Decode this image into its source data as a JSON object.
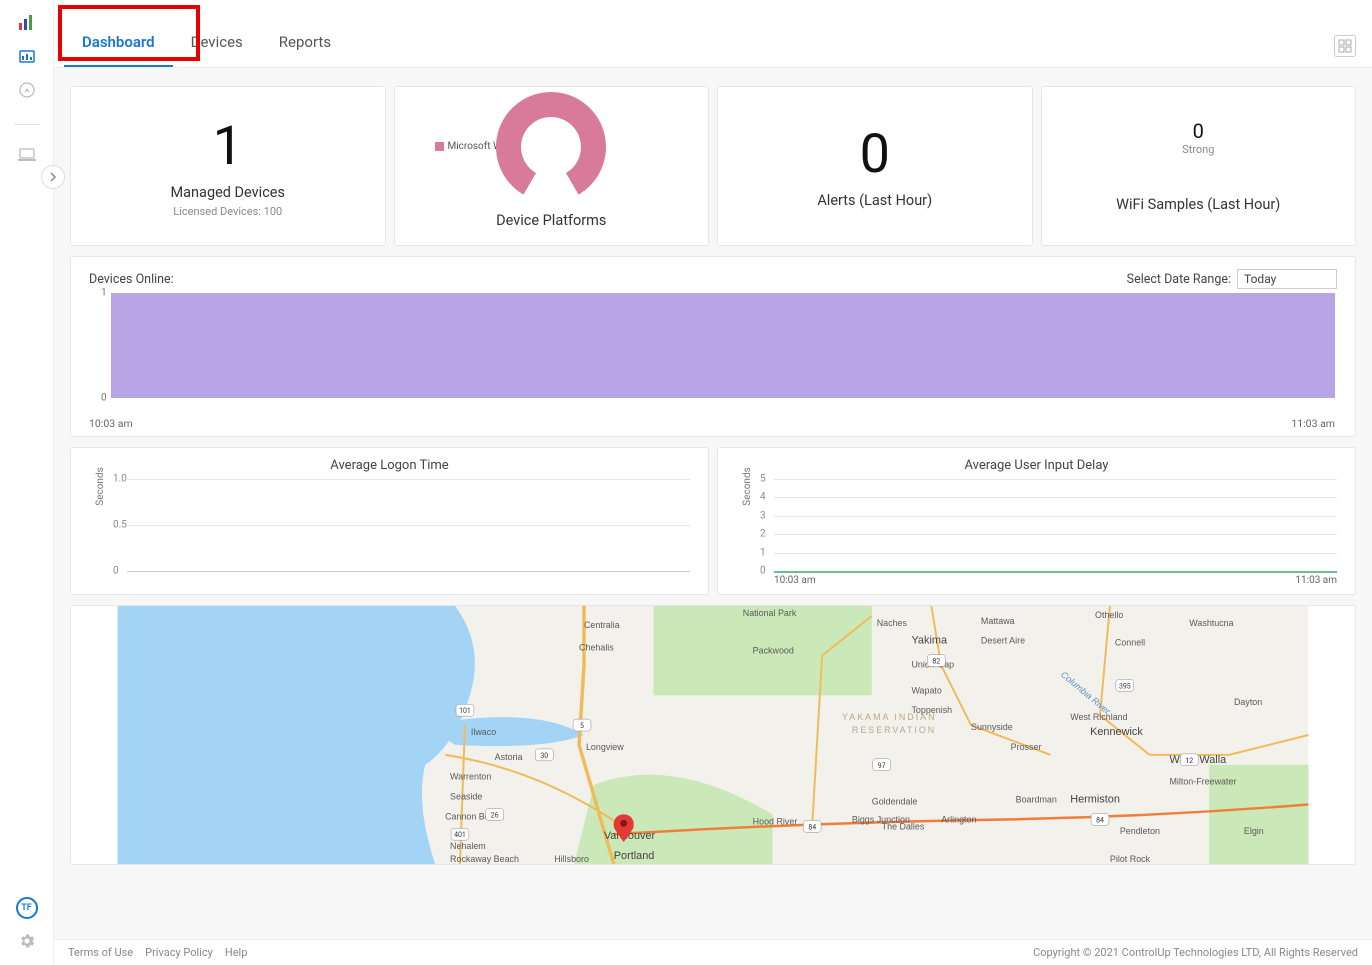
{
  "tabs": {
    "dashboard": "Dashboard",
    "devices": "Devices",
    "reports": "Reports"
  },
  "rail": {
    "avatar": "TF"
  },
  "kpi": {
    "managed": {
      "value": "1",
      "title": "Managed Devices",
      "sub": "Licensed Devices: 100"
    },
    "platforms": {
      "title": "Device Platforms",
      "legend": "Microsoft Windows"
    },
    "alerts": {
      "value": "0",
      "title": "Alerts (Last Hour)"
    },
    "wifi": {
      "value": "0",
      "sub": "Strong",
      "title": "WiFi Samples (Last Hour)"
    }
  },
  "devices_online": {
    "title": "Devices Online:",
    "select_label": "Select Date Range:",
    "select_value": "Today",
    "y0": "0",
    "y1": "1",
    "t_start": "10:03 am",
    "t_end": "11:03 am"
  },
  "logon": {
    "title": "Average Logon Time",
    "yaxis": "Seconds",
    "ticks": [
      "0",
      "0.5",
      "1.0"
    ]
  },
  "uid": {
    "title": "Average User Input Delay",
    "yaxis": "Seconds",
    "ticks": [
      "0",
      "1",
      "2",
      "3",
      "4",
      "5"
    ],
    "t_start": "10:03 am",
    "t_end": "11:03 am"
  },
  "chart_data": [
    {
      "type": "area",
      "title": "Devices Online:",
      "x_range": [
        "10:03 am",
        "11:03 am"
      ],
      "ylim": [
        0,
        1
      ],
      "series": [
        {
          "name": "Devices Online",
          "values_constant": 1
        }
      ]
    },
    {
      "type": "line",
      "title": "Average Logon Time",
      "ylabel": "Seconds",
      "ylim": [
        0,
        1.0
      ],
      "series": [
        {
          "name": "Logon Time",
          "values": []
        }
      ]
    },
    {
      "type": "line",
      "title": "Average User Input Delay",
      "ylabel": "Seconds",
      "ylim": [
        0,
        5
      ],
      "x_range": [
        "10:03 am",
        "11:03 am"
      ],
      "series": [
        {
          "name": "Input Delay",
          "values_constant": 0
        }
      ]
    }
  ],
  "map": {
    "labels": {
      "national_park": "National Park",
      "centralia": "Centralia",
      "chehalis": "Chehalis",
      "packwood": "Packwood",
      "ilwaco": "Ilwaco",
      "astoria": "Astoria",
      "warrenton": "Warrenton",
      "seaside": "Seaside",
      "cannon_beach": "Cannon Beach",
      "nehalem": "Nehalem",
      "rockaway": "Rockaway Beach",
      "longview": "Longview",
      "vancouver": "Vancouver",
      "portland": "Portland",
      "hillsboro": "Hillsboro",
      "yakima": "Yakima",
      "union_gap": "Union Gap",
      "wapato": "Wapato",
      "toppenish": "Toppenish",
      "sunnyside": "Sunnyside",
      "prosser": "Prosser",
      "naches": "Naches",
      "mattawa": "Mattawa",
      "desert_aire": "Desert Aire",
      "yakama": "YAKAMA INDIAN",
      "reservation": "RESERVATION",
      "west_richland": "West Richland",
      "kennewick": "Kennewick",
      "connell": "Connell",
      "othello": "Othello",
      "washtucna": "Washtucna",
      "dayton": "Dayton",
      "walla_walla": "Walla Walla",
      "milton": "Milton-Freewater",
      "pendleton": "Pendleton",
      "hermiston": "Hermiston",
      "boardman": "Boardman",
      "goldendale": "Goldendale",
      "hood_river": "Hood River",
      "the_dalles": "The Dalles",
      "biggs": "Biggs Junction",
      "arlington": "Arlington",
      "pilot_rock": "Pilot Rock",
      "elgin": "Elgin",
      "columbia": "Columbia River"
    }
  },
  "footer": {
    "terms": "Terms of Use",
    "privacy": "Privacy Policy",
    "help": "Help",
    "copyright": "Copyright © 2021 ControlUp Technologies LTD, All Rights Reserved"
  }
}
